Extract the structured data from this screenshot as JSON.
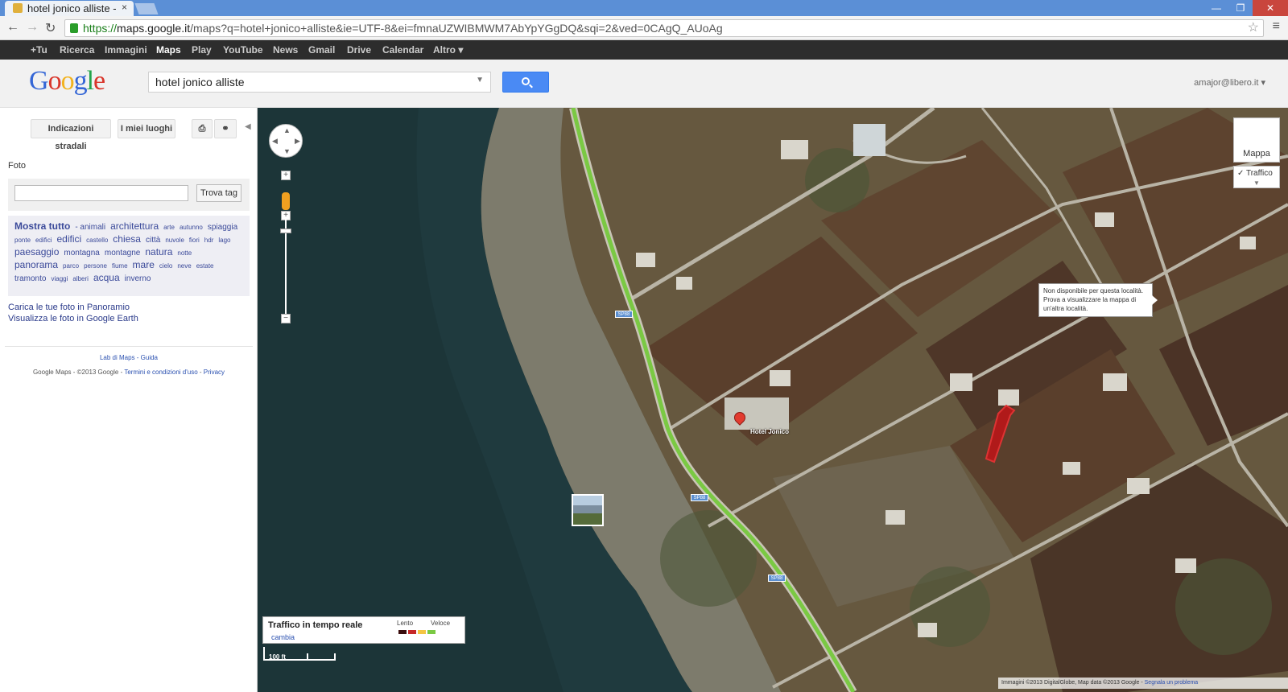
{
  "browser": {
    "tab_title": "hotel jonico alliste -",
    "tab_close": "×",
    "url_secure": "https://",
    "url_host": "maps.google.it",
    "url_rest": "/maps?q=hotel+jonico+alliste&ie=UTF-8&ei=fmnaUZWIBMWM7AbYpYGgDQ&sqi=2&ved=0CAgQ_AUoAg"
  },
  "google_bar": {
    "items": [
      "+Tu",
      "Ricerca",
      "Immagini",
      "Maps",
      "Play",
      "YouTube",
      "News",
      "Gmail",
      "Drive",
      "Calendar",
      "Altro ▾"
    ],
    "active": "Maps"
  },
  "header": {
    "logo": [
      "G",
      "o",
      "o",
      "g",
      "l",
      "e"
    ],
    "search_value": "hotel jonico alliste",
    "account": "amajor@libero.it ▾"
  },
  "left_panel": {
    "directions_button": "Indicazioni stradali",
    "my_places_button": "I miei luoghi",
    "foto_title": "Foto",
    "find_tag_button": "Trova tag",
    "tags": [
      {
        "text": "Mostra tutto",
        "size": 4
      },
      {
        "text": "- animali",
        "size": 2
      },
      {
        "text": "architettura",
        "size": 3
      },
      {
        "text": "arte",
        "size": 1
      },
      {
        "text": "autunno",
        "size": 1
      },
      {
        "text": "spiaggia",
        "size": 2
      },
      {
        "text": "ponte",
        "size": 1
      },
      {
        "text": "edifici",
        "size": 1
      },
      {
        "text": "edifici",
        "size": 3
      },
      {
        "text": "castello",
        "size": 1
      },
      {
        "text": "chiesa",
        "size": 3
      },
      {
        "text": "città",
        "size": 2
      },
      {
        "text": "nuvole",
        "size": 1
      },
      {
        "text": "fiori",
        "size": 1
      },
      {
        "text": "hdr",
        "size": 1
      },
      {
        "text": "lago",
        "size": 1
      },
      {
        "text": "paesaggio",
        "size": 3
      },
      {
        "text": "montagna",
        "size": 2
      },
      {
        "text": "montagne",
        "size": 2
      },
      {
        "text": "natura",
        "size": 3
      },
      {
        "text": "notte",
        "size": 1
      },
      {
        "text": "panorama",
        "size": 3
      },
      {
        "text": "parco",
        "size": 1
      },
      {
        "text": "persone",
        "size": 1
      },
      {
        "text": "fiume",
        "size": 1
      },
      {
        "text": "mare",
        "size": 3
      },
      {
        "text": "cielo",
        "size": 1
      },
      {
        "text": "neve",
        "size": 1
      },
      {
        "text": "estate",
        "size": 1
      },
      {
        "text": "tramonto",
        "size": 2
      },
      {
        "text": "viaggi",
        "size": 1
      },
      {
        "text": "alberi",
        "size": 1
      },
      {
        "text": "acqua",
        "size": 3
      },
      {
        "text": "inverno",
        "size": 2
      }
    ],
    "link_panoramio": "Carica le tue foto in Panoramio",
    "link_earth": "Visualizza le foto in Google Earth",
    "labs_line": "Lab di Maps - Guida",
    "footer_text": "Google Maps - ©2013 Google - ",
    "footer_terms": "Termini e condizioni d'uso",
    "footer_sep": " - ",
    "footer_privacy": "Privacy"
  },
  "map": {
    "map_type": "Mappa",
    "traffic_toggle": "✓ Traffico",
    "tooltip": "Non disponibile per questa località. Prova a visualizzare la mappa di un'altra località.",
    "hotel_label": "Hotel Jonico",
    "road_badges": [
      "SP88",
      "SP88",
      "SP88"
    ],
    "traffic_legend": {
      "title": "Traffico in tempo reale",
      "change": "cambia",
      "slow": "Lento",
      "fast": "Veloce",
      "colors": [
        "#3a0d0d",
        "#c62828",
        "#f4c542",
        "#7ac943"
      ]
    },
    "scale_label": "100 ft",
    "attribution": "Immagini ©2013 DigitalGlobe, Map data ©2013 Google - ",
    "report_link": "Segnala un problema"
  },
  "colors": {
    "sea": "#1f3a3e",
    "land": "#6b5c45",
    "road_traffic": "#7ac943",
    "accent_blue": "#4a8af4"
  }
}
